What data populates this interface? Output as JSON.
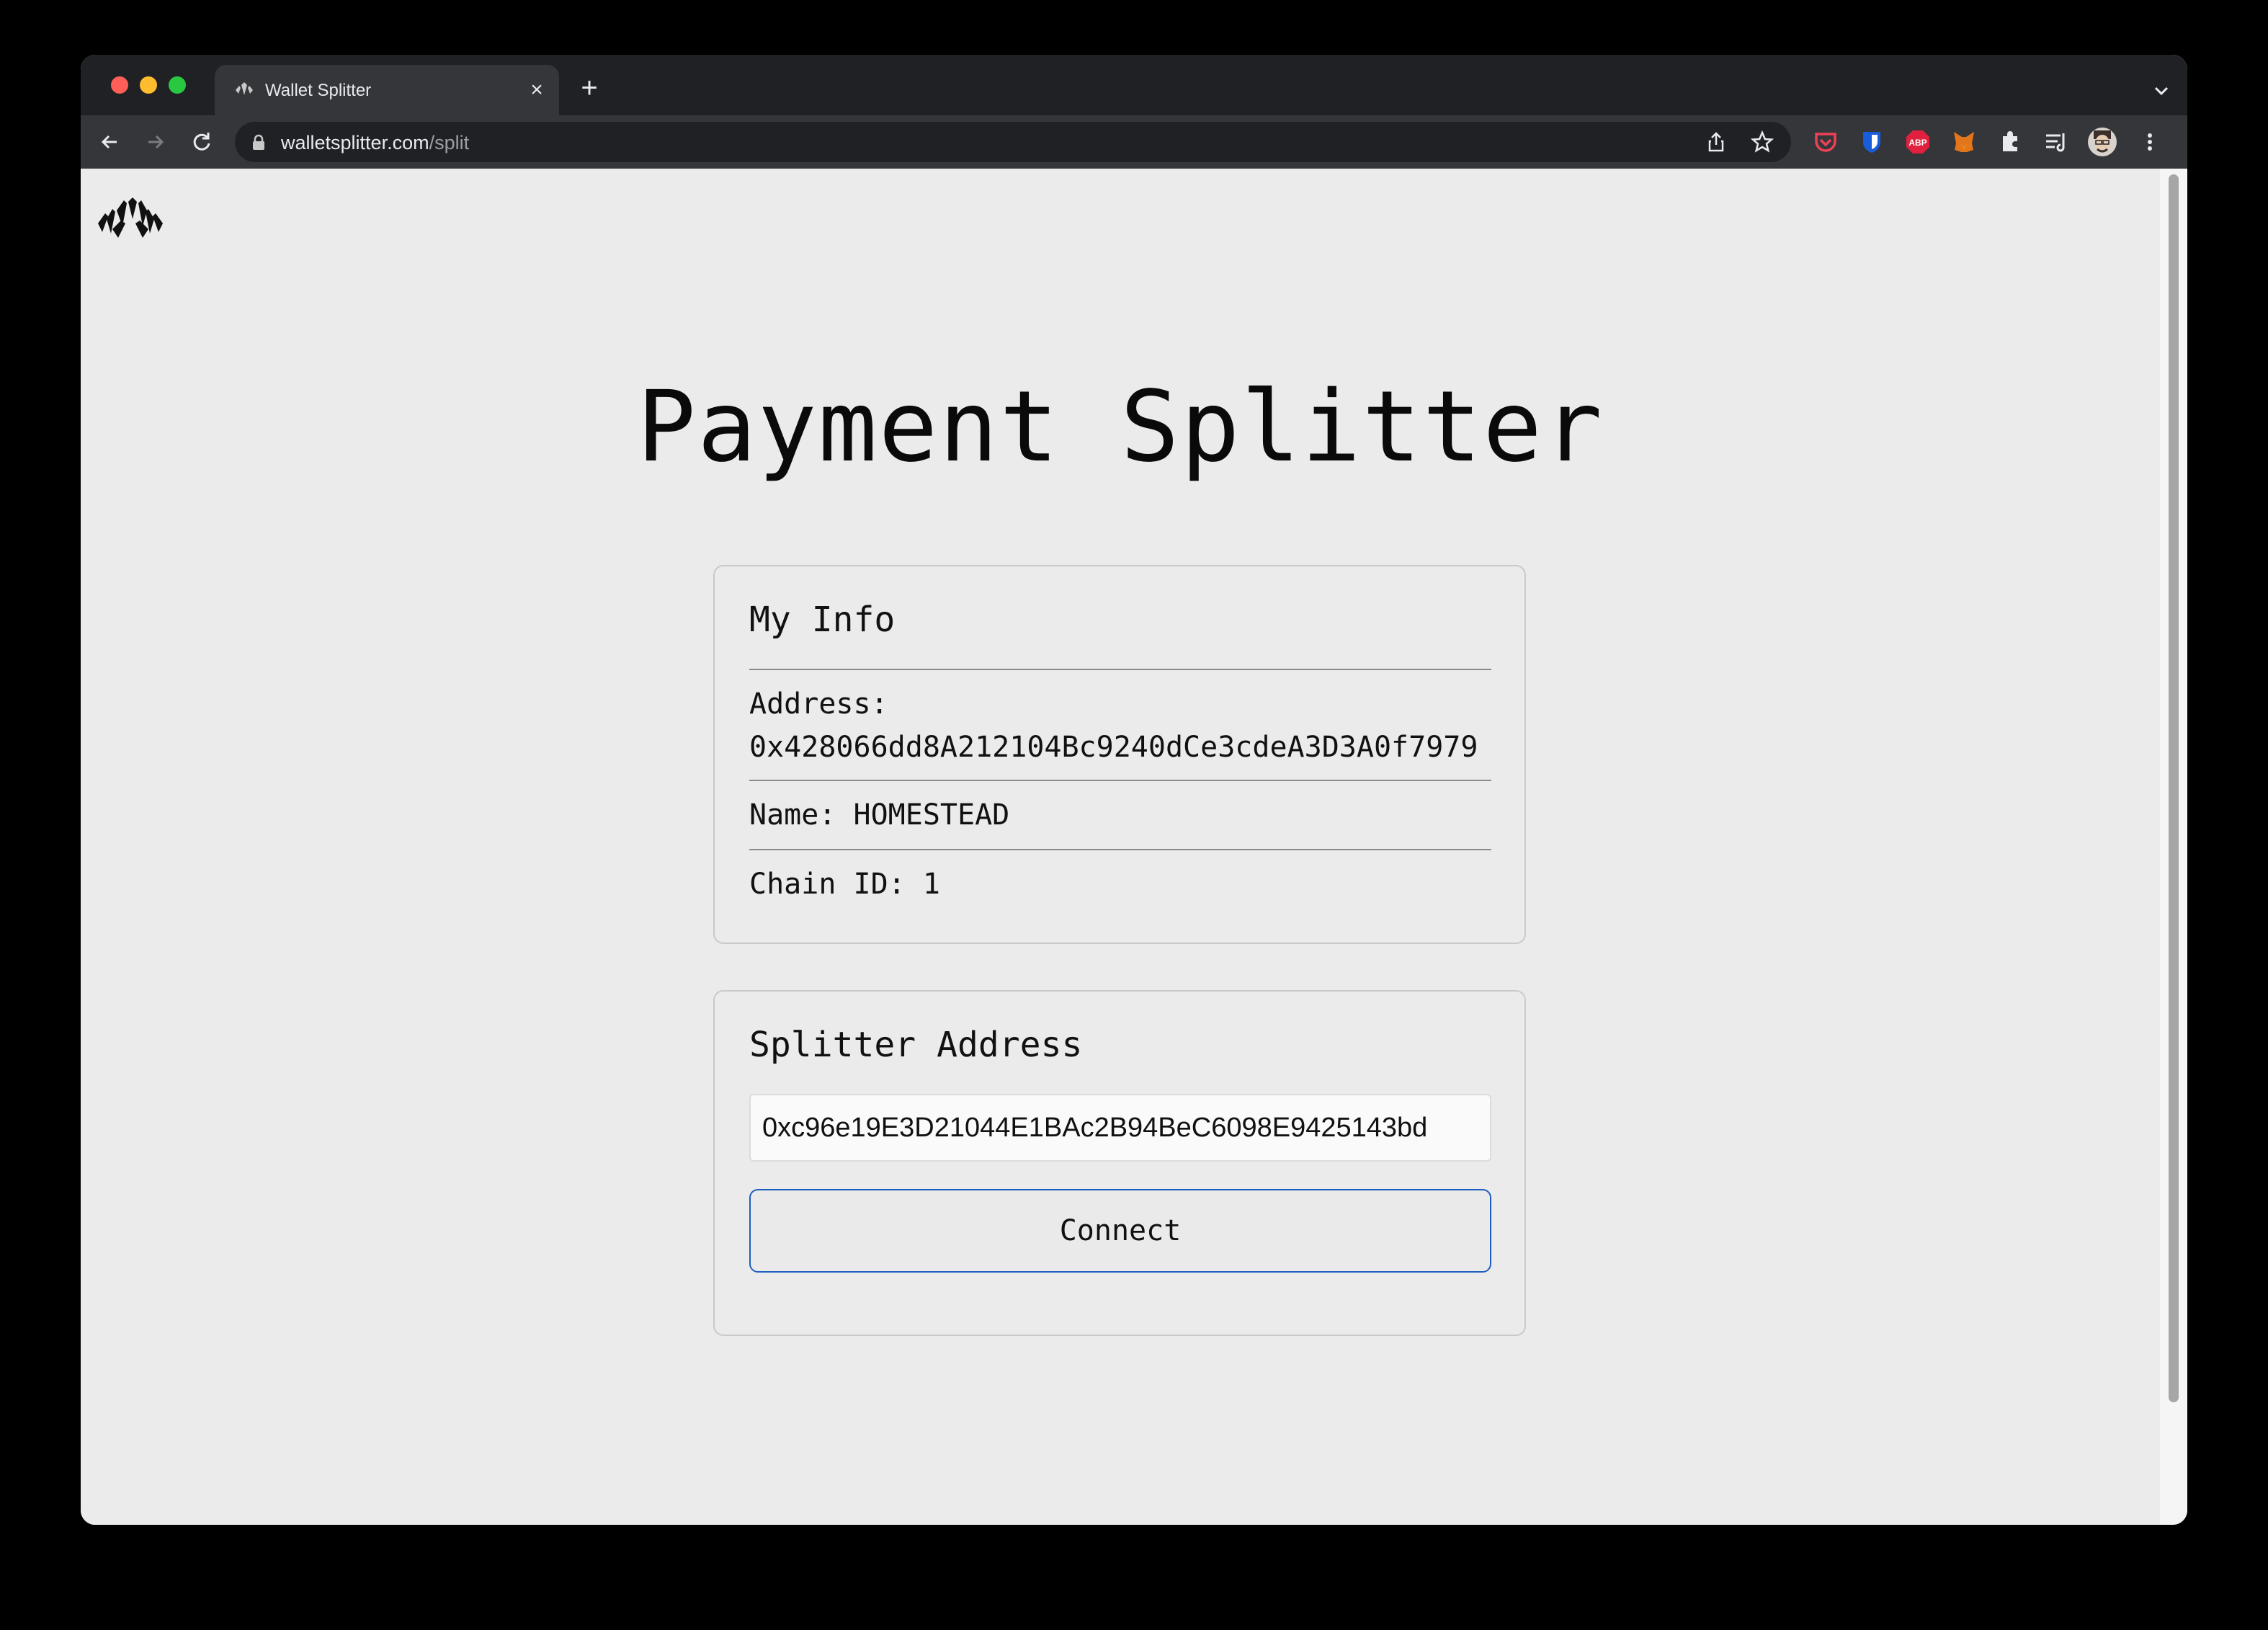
{
  "browser": {
    "tab_title": "Wallet Splitter",
    "url_host": "walletsplitter.com",
    "url_path": "/split"
  },
  "page": {
    "title": "Payment Splitter"
  },
  "my_info": {
    "heading": "My Info",
    "address_label": "Address:",
    "address_value": "0x428066dd8A212104Bc9240dCe3cdeA3D3A0f7979",
    "name_text": "Name: HOMESTEAD",
    "chain_text": "Chain ID: 1"
  },
  "splitter": {
    "heading": "Splitter Address",
    "input_value": "0xc96e19E3D21044E1BAc2B94BeC6098E9425143bd",
    "connect_label": "Connect"
  },
  "colors": {
    "page_bg": "#ebebeb",
    "button_border": "#1f5fbf"
  }
}
